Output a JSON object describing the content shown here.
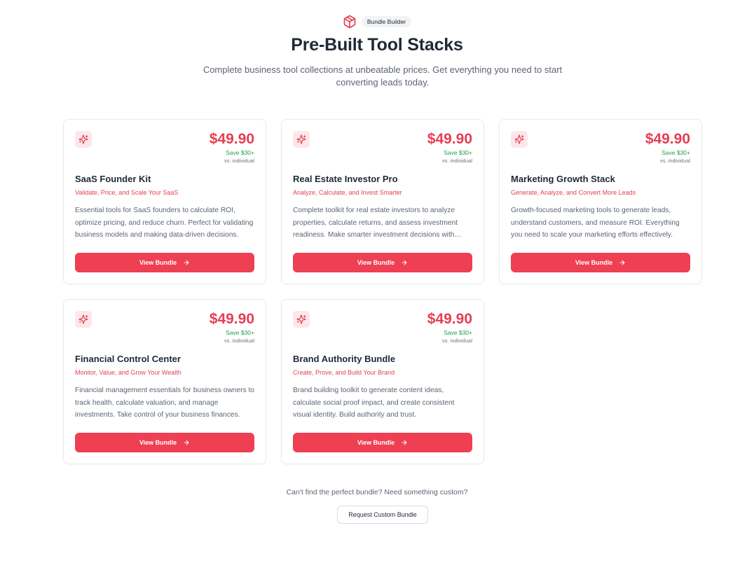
{
  "header": {
    "badge": "Bundle Builder",
    "title": "Pre-Built Tool Stacks",
    "subtitle": "Complete business tool collections at unbeatable prices. Get everything you need to start converting leads today."
  },
  "bundles": [
    {
      "price": "$49.90",
      "save": "Save $30+",
      "vs": "vs. individual",
      "title": "SaaS Founder Kit",
      "tagline": "Validate, Price, and Scale Your SaaS",
      "description": "Essential tools for SaaS founders to calculate ROI, optimize pricing, and reduce churn. Perfect for validating business models and making data-driven decisions.",
      "button": "View Bundle"
    },
    {
      "price": "$49.90",
      "save": "Save $30+",
      "vs": "vs. individual",
      "title": "Real Estate Investor Pro",
      "tagline": "Analyze, Calculate, and Invest Smarter",
      "description": "Complete toolkit for real estate investors to analyze properties, calculate returns, and assess investment readiness. Make smarter investment decisions with confidence.",
      "button": "View Bundle"
    },
    {
      "price": "$49.90",
      "save": "Save $30+",
      "vs": "vs. individual",
      "title": "Marketing Growth Stack",
      "tagline": "Generate, Analyze, and Convert More Leads",
      "description": "Growth-focused marketing tools to generate leads, understand customers, and measure ROI. Everything you need to scale your marketing efforts effectively.",
      "button": "View Bundle"
    },
    {
      "price": "$49.90",
      "save": "Save $30+",
      "vs": "vs. individual",
      "title": "Financial Control Center",
      "tagline": "Monitor, Value, and Grow Your Wealth",
      "description": "Financial management essentials for business owners to track health, calculate valuation, and manage investments. Take control of your business finances.",
      "button": "View Bundle"
    },
    {
      "price": "$49.90",
      "save": "Save $30+",
      "vs": "vs. individual",
      "title": "Brand Authority Bundle",
      "tagline": "Create, Prove, and Build Your Brand",
      "description": "Brand building toolkit to generate content ideas, calculate social proof impact, and create consistent visual identity. Build authority and trust.",
      "button": "View Bundle"
    }
  ],
  "footer": {
    "question": "Can't find the perfect bundle? Need something custom?",
    "button": "Request Custom Bundle"
  },
  "colors": {
    "accent": "#ee3f53",
    "price": "#e63e52",
    "save": "#1f9e47",
    "icon_bg": "#fde7ea"
  },
  "icons": {
    "header": "box-icon",
    "card": "sparkles-icon",
    "button": "arrow-right-icon"
  }
}
